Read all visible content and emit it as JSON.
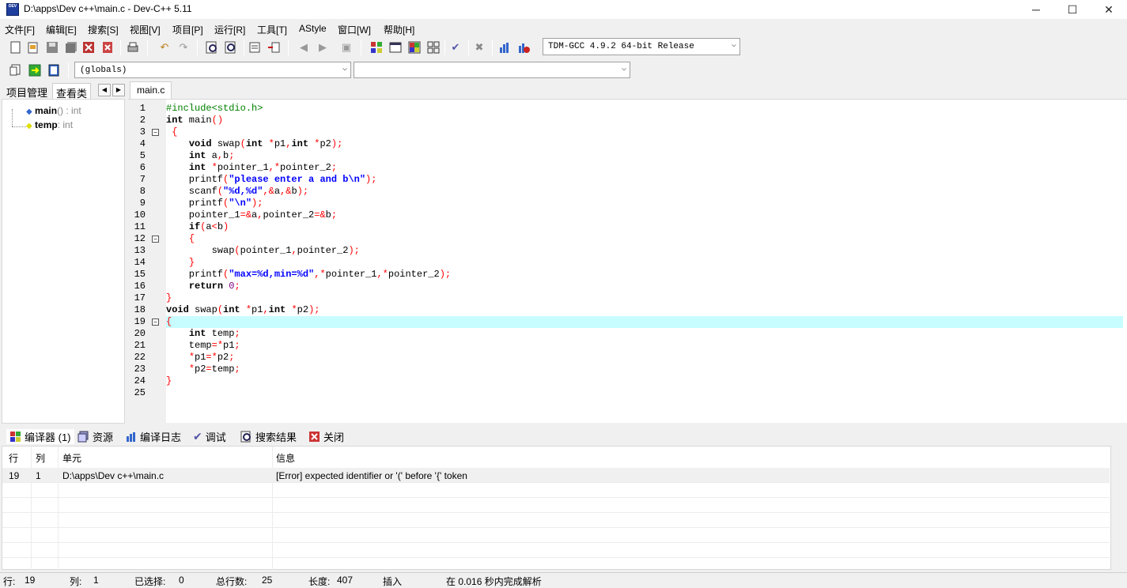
{
  "window": {
    "title": "D:\\apps\\Dev c++\\main.c - Dev-C++ 5.11",
    "app_icon_text": "DEV",
    "minimize": "─",
    "maximize": "☐",
    "close": "✕"
  },
  "menu": [
    "文件[F]",
    "编辑[E]",
    "搜索[S]",
    "视图[V]",
    "项目[P]",
    "运行[R]",
    "工具[T]",
    "AStyle",
    "窗口[W]",
    "帮助[H]"
  ],
  "toolbar": {
    "compiler_select": "TDM-GCC 4.9.2 64-bit Release",
    "scope_select": "(globals)",
    "symbol_select": ""
  },
  "left_panel": {
    "tabs": [
      "项目管理",
      "查看类"
    ],
    "active_tab": "查看类",
    "tree": [
      {
        "name": "main",
        "sig": "() : int"
      },
      {
        "name": "temp",
        "sig": ": int"
      }
    ]
  },
  "editor": {
    "tab": "main.c",
    "current_line": 19,
    "lines": [
      "#include<stdio.h>",
      "int main()",
      " {",
      "    void swap(int *p1,int *p2);",
      "    int a,b;",
      "    int *pointer_1,*pointer_2;",
      "    printf(\"please enter a and b\\n\");",
      "    scanf(\"%d,%d\",&a,&b);",
      "    printf(\"\\n\");",
      "    pointer_1=&a,pointer_2=&b;",
      "    if(a<b)",
      "    {",
      "        swap(pointer_1,pointer_2);",
      "    }",
      "    printf(\"max=%d,min=%d\",*pointer_1,*pointer_2);",
      "    return 0;",
      "}",
      "void swap(int *p1,int *p2);",
      "{",
      "    int temp;",
      "    temp=*p1;",
      "    *p1=*p2;",
      "    *p2=temp;",
      "}",
      ""
    ],
    "fold_lines": [
      3,
      12,
      19
    ]
  },
  "bottom_panel": {
    "tabs": [
      "编译器 (1)",
      "资源",
      "编译日志",
      "调试",
      "搜索结果",
      "关闭"
    ],
    "columns": [
      "行",
      "列",
      "单元",
      "信息"
    ],
    "rows": [
      {
        "line": "19",
        "col": "1",
        "unit": "D:\\apps\\Dev c++\\main.c",
        "message": "[Error] expected identifier or '(' before '{' token"
      }
    ]
  },
  "status": {
    "line_label": "行:",
    "line_value": "19",
    "col_label": "列:",
    "col_value": "1",
    "sel_label": "已选择:",
    "sel_value": "0",
    "total_label": "总行数:",
    "total_value": "25",
    "len_label": "长度:",
    "len_value": "407",
    "mode": "插入",
    "parse_msg": "在 0.016 秒内完成解析"
  }
}
